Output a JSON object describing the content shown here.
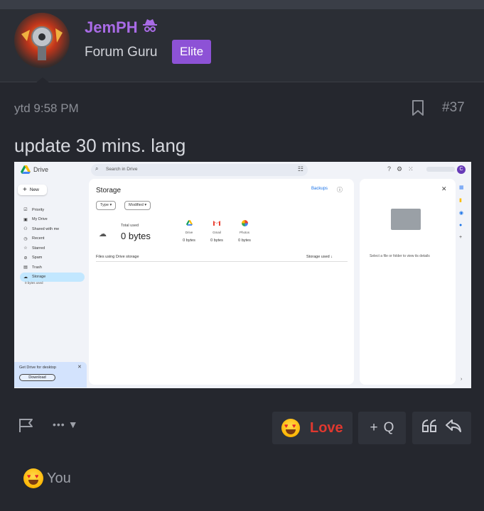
{
  "user": {
    "name": "JemPH",
    "title": "Forum Guru",
    "badge": "Elite",
    "name_color": "#a96be6",
    "badge_color": "#8d52d6"
  },
  "post": {
    "time": "ytd 9:58 PM",
    "number": "#37",
    "body": "update 30 mins. lang"
  },
  "screenshot": {
    "app_title": "Drive",
    "search_placeholder": "Search in Drive",
    "avatar_initial": "C",
    "new_label": "New",
    "nav": [
      "Priority",
      "My Drive",
      "Shared with me",
      "Recent",
      "Starred",
      "Spam",
      "Trash",
      "Storage"
    ],
    "storage_used_small": "0 bytes used",
    "promo_text": "Get Drive for desktop",
    "promo_button": "Download",
    "main_title": "Storage",
    "backups_link": "Backups",
    "filter_type": "Type",
    "filter_modified": "Modified",
    "total_label": "Total used",
    "total_value": "0 bytes",
    "services": [
      {
        "name": "Drive",
        "value": "0 bytes",
        "icon": "drive-icon"
      },
      {
        "name": "Gmail",
        "value": "0 bytes",
        "icon": "gmail-icon"
      },
      {
        "name": "Photos",
        "value": "0 bytes",
        "icon": "photos-icon"
      }
    ],
    "files_label": "Files using Drive storage",
    "sort_label": "Storage used",
    "details_text": "Select a file or folder to view its details"
  },
  "actions": {
    "react_label": "Love",
    "reactions_summary": "You",
    "react_color": "#e0382f"
  }
}
